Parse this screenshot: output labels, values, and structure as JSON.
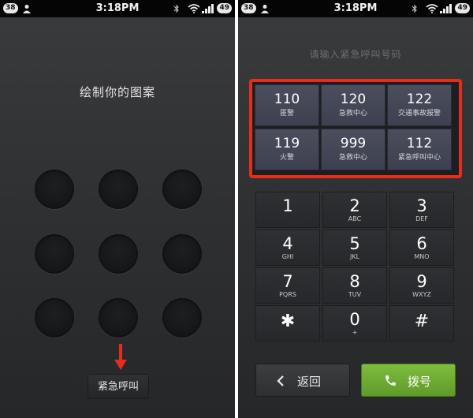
{
  "status_bar": {
    "left_badge": "38",
    "time": "3:18PM",
    "battery": "49"
  },
  "lock_screen": {
    "title": "绘制你的图案",
    "emergency_button": "紧急呼叫"
  },
  "dialer": {
    "hint": "请输入紧急呼叫号码",
    "emergency_numbers": [
      {
        "number": "110",
        "label": "匪警"
      },
      {
        "number": "120",
        "label": "急救中心"
      },
      {
        "number": "122",
        "label": "交通事故报警"
      },
      {
        "number": "119",
        "label": "火警"
      },
      {
        "number": "999",
        "label": "急救中心"
      },
      {
        "number": "112",
        "label": "紧急呼叫中心"
      }
    ],
    "keys": [
      {
        "digit": "1",
        "letters": ""
      },
      {
        "digit": "2",
        "letters": "ABC"
      },
      {
        "digit": "3",
        "letters": "DEF"
      },
      {
        "digit": "4",
        "letters": "GHI"
      },
      {
        "digit": "5",
        "letters": "JKL"
      },
      {
        "digit": "6",
        "letters": "MNO"
      },
      {
        "digit": "7",
        "letters": "PQRS"
      },
      {
        "digit": "8",
        "letters": "TUV"
      },
      {
        "digit": "9",
        "letters": "WXYZ"
      },
      {
        "digit": "✱",
        "letters": ""
      },
      {
        "digit": "0",
        "letters": "+"
      },
      {
        "digit": "#",
        "letters": ""
      }
    ],
    "back_button": "返回",
    "call_button": "拨号"
  },
  "colors": {
    "highlight_frame": "#e62c1c",
    "call_green": "#6aa932"
  }
}
